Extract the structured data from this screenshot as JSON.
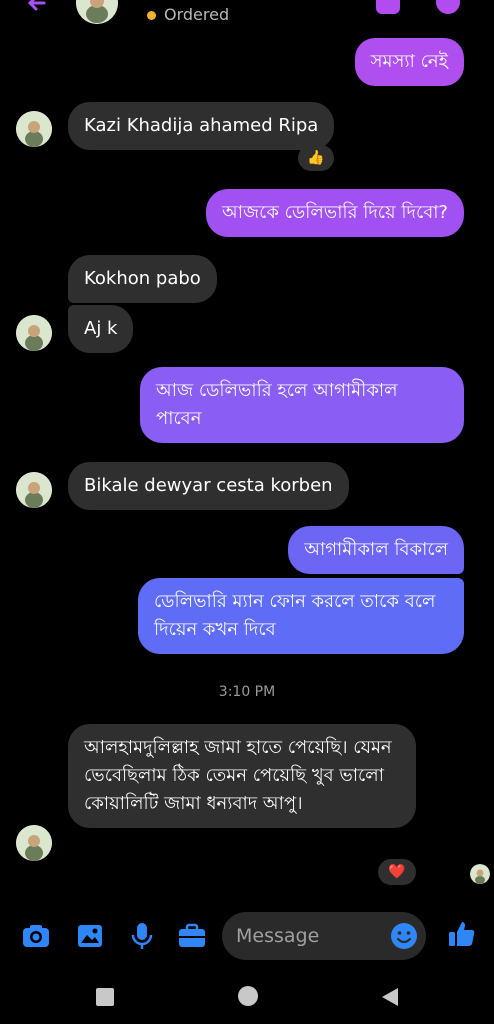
{
  "header": {
    "status_text": "Ordered",
    "status_color": "#f2b430",
    "back_icon": "back-arrow-icon",
    "action_icons": [
      "video-call-icon",
      "info-icon"
    ]
  },
  "messages": [
    {
      "dir": "out",
      "text": "সমস্যা নেই"
    },
    {
      "dir": "in",
      "text": "Kazi Khadija ahamed Ripa",
      "reaction": "👍"
    },
    {
      "dir": "out",
      "text": "আজকে ডেলিভারি দিয়ে দিবো?"
    },
    {
      "dir": "in",
      "text": "Kokhon pabo"
    },
    {
      "dir": "in",
      "text": "Aj k"
    },
    {
      "dir": "out",
      "text": "আজ ডেলিভারি হলে আগামীকাল পাবেন"
    },
    {
      "dir": "in",
      "text": "Bikale dewyar cesta korben"
    },
    {
      "dir": "out",
      "text": "আগামীকাল বিকালে"
    },
    {
      "dir": "out",
      "text": "ডেলিভারি ম্যান ফোন করলে তাকে বলে দিয়েন কখন দিবে"
    },
    {
      "dir": "in",
      "text": "আলহামদুলিল্লাহ জামা হাতে পেয়েছি। যেমন ভেবেছিলাম ঠিক তেমন পেয়েছি খুব ভালো কোয়ালিটি জামা ধন্যবাদ আপু।",
      "reaction": "❤️"
    }
  ],
  "timestamp": "3:10 PM",
  "composer": {
    "placeholder": "Message",
    "icons": [
      "camera-icon",
      "gallery-icon",
      "microphone-icon",
      "briefcase-icon",
      "emoji-icon",
      "thumbs-up-icon"
    ]
  },
  "navbar": {
    "icons": [
      "recent-apps-icon",
      "home-icon",
      "back-icon"
    ]
  },
  "colors": {
    "outgoing_top": "#a950f2",
    "outgoing_bottom": "#5f6df6",
    "incoming": "#2f2f2f",
    "accent": "#2f86f6"
  }
}
